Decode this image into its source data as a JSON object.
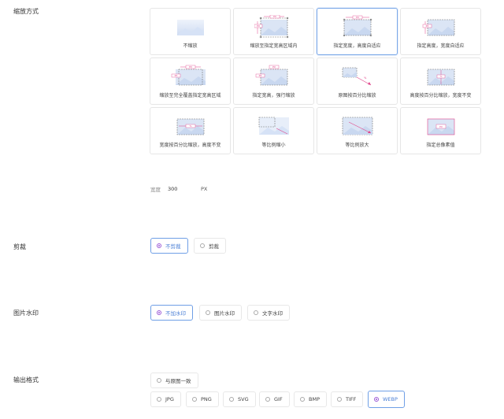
{
  "sections": {
    "scale": "缩放方式",
    "crop": "剪裁",
    "watermark": "图片水印",
    "format": "输出格式"
  },
  "scale_options": [
    {
      "label": "不缩放",
      "tag": "",
      "selected": false
    },
    {
      "label": "缩放至指定宽高区域内",
      "tag": "PX",
      "selected": false
    },
    {
      "label": "指定宽度，高度自适应",
      "tag": "PX",
      "selected": true
    },
    {
      "label": "指定高度，宽度自适应",
      "tag": "PX",
      "selected": false
    },
    {
      "label": "缩放至完全覆盖指定宽高区域",
      "tag": "PX",
      "selected": false
    },
    {
      "label": "指定宽高，强行缩放",
      "tag": "PX",
      "selected": false
    },
    {
      "label": "原图按百分比缩放",
      "tag": "%",
      "selected": false
    },
    {
      "label": "高度按百分比缩放，宽度不变",
      "tag": "%",
      "selected": false
    },
    {
      "label": "宽度按百分比缩放，高度不变",
      "tag": "%",
      "selected": false
    },
    {
      "label": "等比例缩小",
      "tag": "",
      "selected": false
    },
    {
      "label": "等比例放大",
      "tag": "",
      "selected": false
    },
    {
      "label": "指定总像素值",
      "tag": "PX",
      "selected": false
    }
  ],
  "width_field": {
    "label": "宽度",
    "value": "300",
    "unit": "PX"
  },
  "crop_options": [
    {
      "label": "不剪裁",
      "checked": true
    },
    {
      "label": "剪裁",
      "checked": false
    }
  ],
  "watermark_options": [
    {
      "label": "不加水印",
      "checked": true
    },
    {
      "label": "图片水印",
      "checked": false
    },
    {
      "label": "文字水印",
      "checked": false
    }
  ],
  "format_options_row1": [
    {
      "label": "与原图一致",
      "checked": false
    }
  ],
  "format_options_row2": [
    {
      "label": "JPG",
      "checked": false
    },
    {
      "label": "PNG",
      "checked": false
    },
    {
      "label": "SVG",
      "checked": false
    },
    {
      "label": "GIF",
      "checked": false
    },
    {
      "label": "BMP",
      "checked": false
    },
    {
      "label": "TIFF",
      "checked": false
    },
    {
      "label": "WEBP",
      "checked": true
    }
  ],
  "colors": {
    "accent": "#4a7fd6",
    "marker": "#e0458a",
    "radio": "#9b5ad6"
  }
}
